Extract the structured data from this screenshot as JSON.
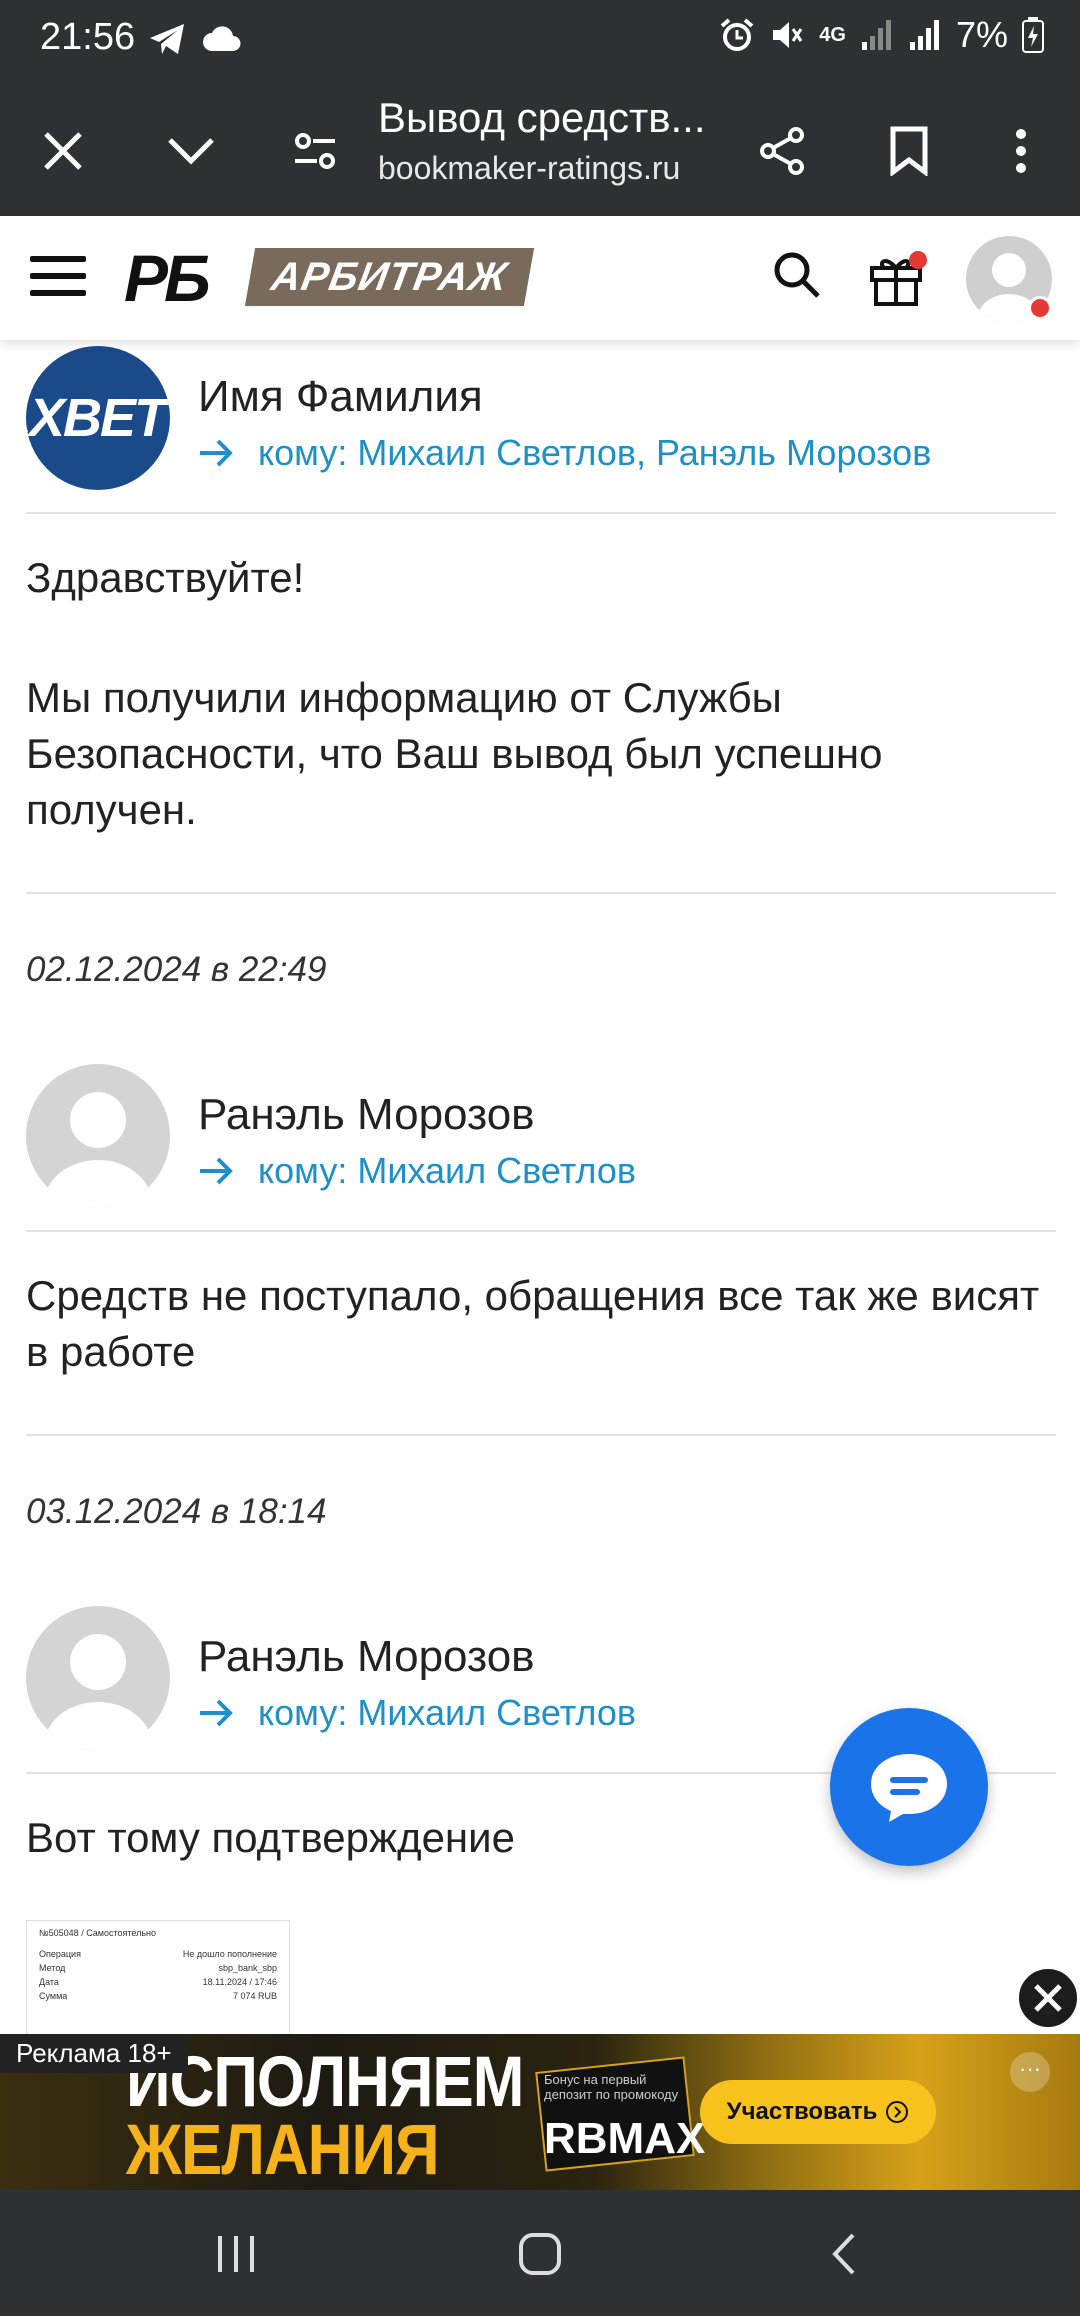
{
  "status_bar": {
    "time": "21:56",
    "battery": "7%",
    "network": "4G",
    "icons": [
      "telegram-icon",
      "cloud-icon",
      "alarm-icon",
      "mute-icon",
      "signal-icon",
      "signal-icon",
      "battery-icon"
    ]
  },
  "browser": {
    "tab_title": "Вывод средств...",
    "url": "bookmaker-ratings.ru"
  },
  "site_header": {
    "logo_main": "РБ",
    "logo_sub": "АРБИТРАЖ"
  },
  "messages": [
    {
      "avatar_text": "1XBET",
      "sender": "Имя Фамилия",
      "recipients": "кому: Михаил Светлов, Ранэль Морозов",
      "body_p1": "Здравствуйте!",
      "body_p2": "Мы получили информацию от Службы Безопасности, что Ваш вывод был успешно получен."
    },
    {
      "date": "02.12.2024 в 22:49",
      "sender": "Ранэль Морозов",
      "recipients": "кому: Михаил Светлов",
      "body": "Средств не поступало, обращения все так же висят в работе"
    },
    {
      "date": "03.12.2024 в 18:14",
      "sender": "Ранэль Морозов",
      "recipients": "кому: Михаил Светлов",
      "body": "Вот тому подтверждение"
    }
  ],
  "thumbnail": {
    "header": "№505048 / Самостоятельно",
    "rows": [
      {
        "label": "Операция",
        "value": "Не дошло пополнение"
      },
      {
        "label": "Метод",
        "value": "sbp_bank_sbp"
      },
      {
        "label": "Дата",
        "value": "18.11.2024 / 17:46"
      },
      {
        "label": "Сумма",
        "value": "7 074 RUB"
      }
    ]
  },
  "ad": {
    "label": "Реклама 18+",
    "line1": "ИСПОЛНЯЕМ",
    "line2": "ЖЕЛАНИЯ",
    "small": "Бонус на первый депозит по промокоду",
    "promo": "RBMAX",
    "button": "Участвовать"
  }
}
